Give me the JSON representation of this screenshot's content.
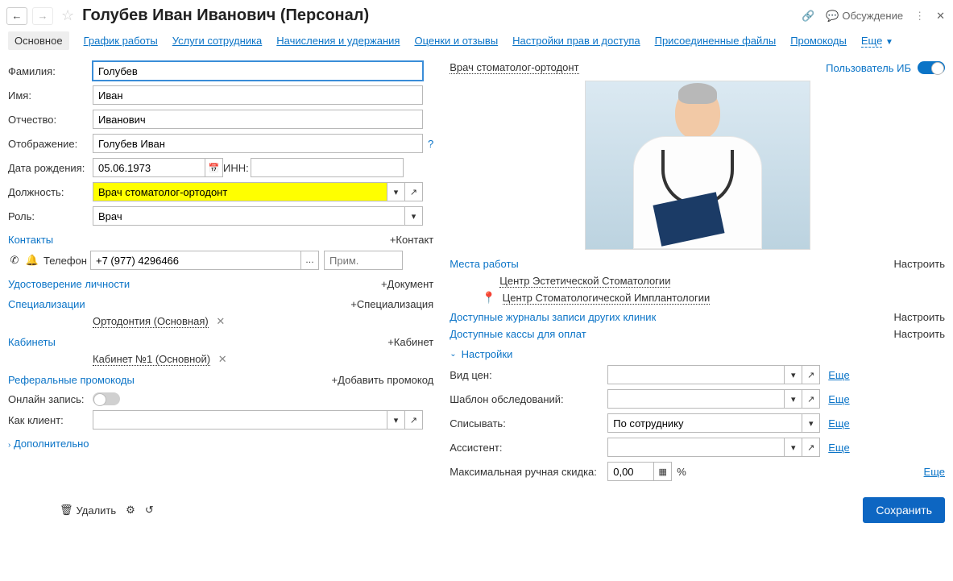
{
  "header": {
    "title": "Голубев Иван Иванович (Персонал)",
    "discuss": "Обсуждение"
  },
  "tabs": {
    "main": "Основное",
    "schedule": "График работы",
    "services": "Услуги сотрудника",
    "charges": "Начисления и удержания",
    "reviews": "Оценки и отзывы",
    "rights": "Настройки прав и доступа",
    "files": "Присоединенные файлы",
    "promo": "Промокоды",
    "more": "Еще"
  },
  "left": {
    "labels": {
      "surname": "Фамилия:",
      "name": "Имя:",
      "patronymic": "Отчество:",
      "display": "Отображение:",
      "dob": "Дата рождения:",
      "inn": "ИНН:",
      "position": "Должность:",
      "role": "Роль:",
      "phone": "Телефон",
      "online": "Онлайн запись:",
      "as_client": "Как клиент:"
    },
    "values": {
      "surname": "Голубев",
      "name": "Иван",
      "patronymic": "Иванович",
      "display": "Голубев Иван",
      "dob": "05.06.1973",
      "inn": "",
      "position": "Врач стоматолог-ортодонт",
      "role": "Врач",
      "phone": "+7 (977) 4296466",
      "phone_note_ph": "Прим.",
      "as_client": ""
    },
    "sections": {
      "contacts": "Контакты",
      "add_contact": "+Контакт",
      "identity": "Удостоверение личности",
      "add_doc": "+Документ",
      "specializations": "Специализации",
      "add_spec": "+Специализация",
      "spec_item": "Ортодонтия (Основная)",
      "cabinets": "Кабинеты",
      "add_cab": "+Кабинет",
      "cab_item": "Кабинет №1 (Основной)",
      "ref_promo": "Реферальные промокоды",
      "add_promo": "+Добавить промокод",
      "additional": "Дополнительно"
    }
  },
  "right": {
    "occupation_link": "Врач стоматолог-ортодонт",
    "ib_user": "Пользователь ИБ",
    "workplaces": "Места работы",
    "configure": "Настроить",
    "loc1": "Центр Эстетической Стоматологии",
    "loc2": "Центр Стоматологической Имплантологии",
    "journals": "Доступные журналы записи других клиник",
    "cash": "Доступные кассы для оплат",
    "settings": "Настройки",
    "labels": {
      "price_type": "Вид цен:",
      "exam_tpl": "Шаблон обследований:",
      "writeoff": "Списывать:",
      "assistant": "Ассистент:",
      "max_discount": "Максимальная ручная скидка:"
    },
    "values": {
      "price_type": "",
      "exam_tpl": "",
      "writeoff": "По сотруднику",
      "assistant": "",
      "max_discount": "0,00"
    },
    "more": "Еще",
    "percent": "%"
  },
  "footer": {
    "delete": "Удалить",
    "save": "Сохранить"
  }
}
